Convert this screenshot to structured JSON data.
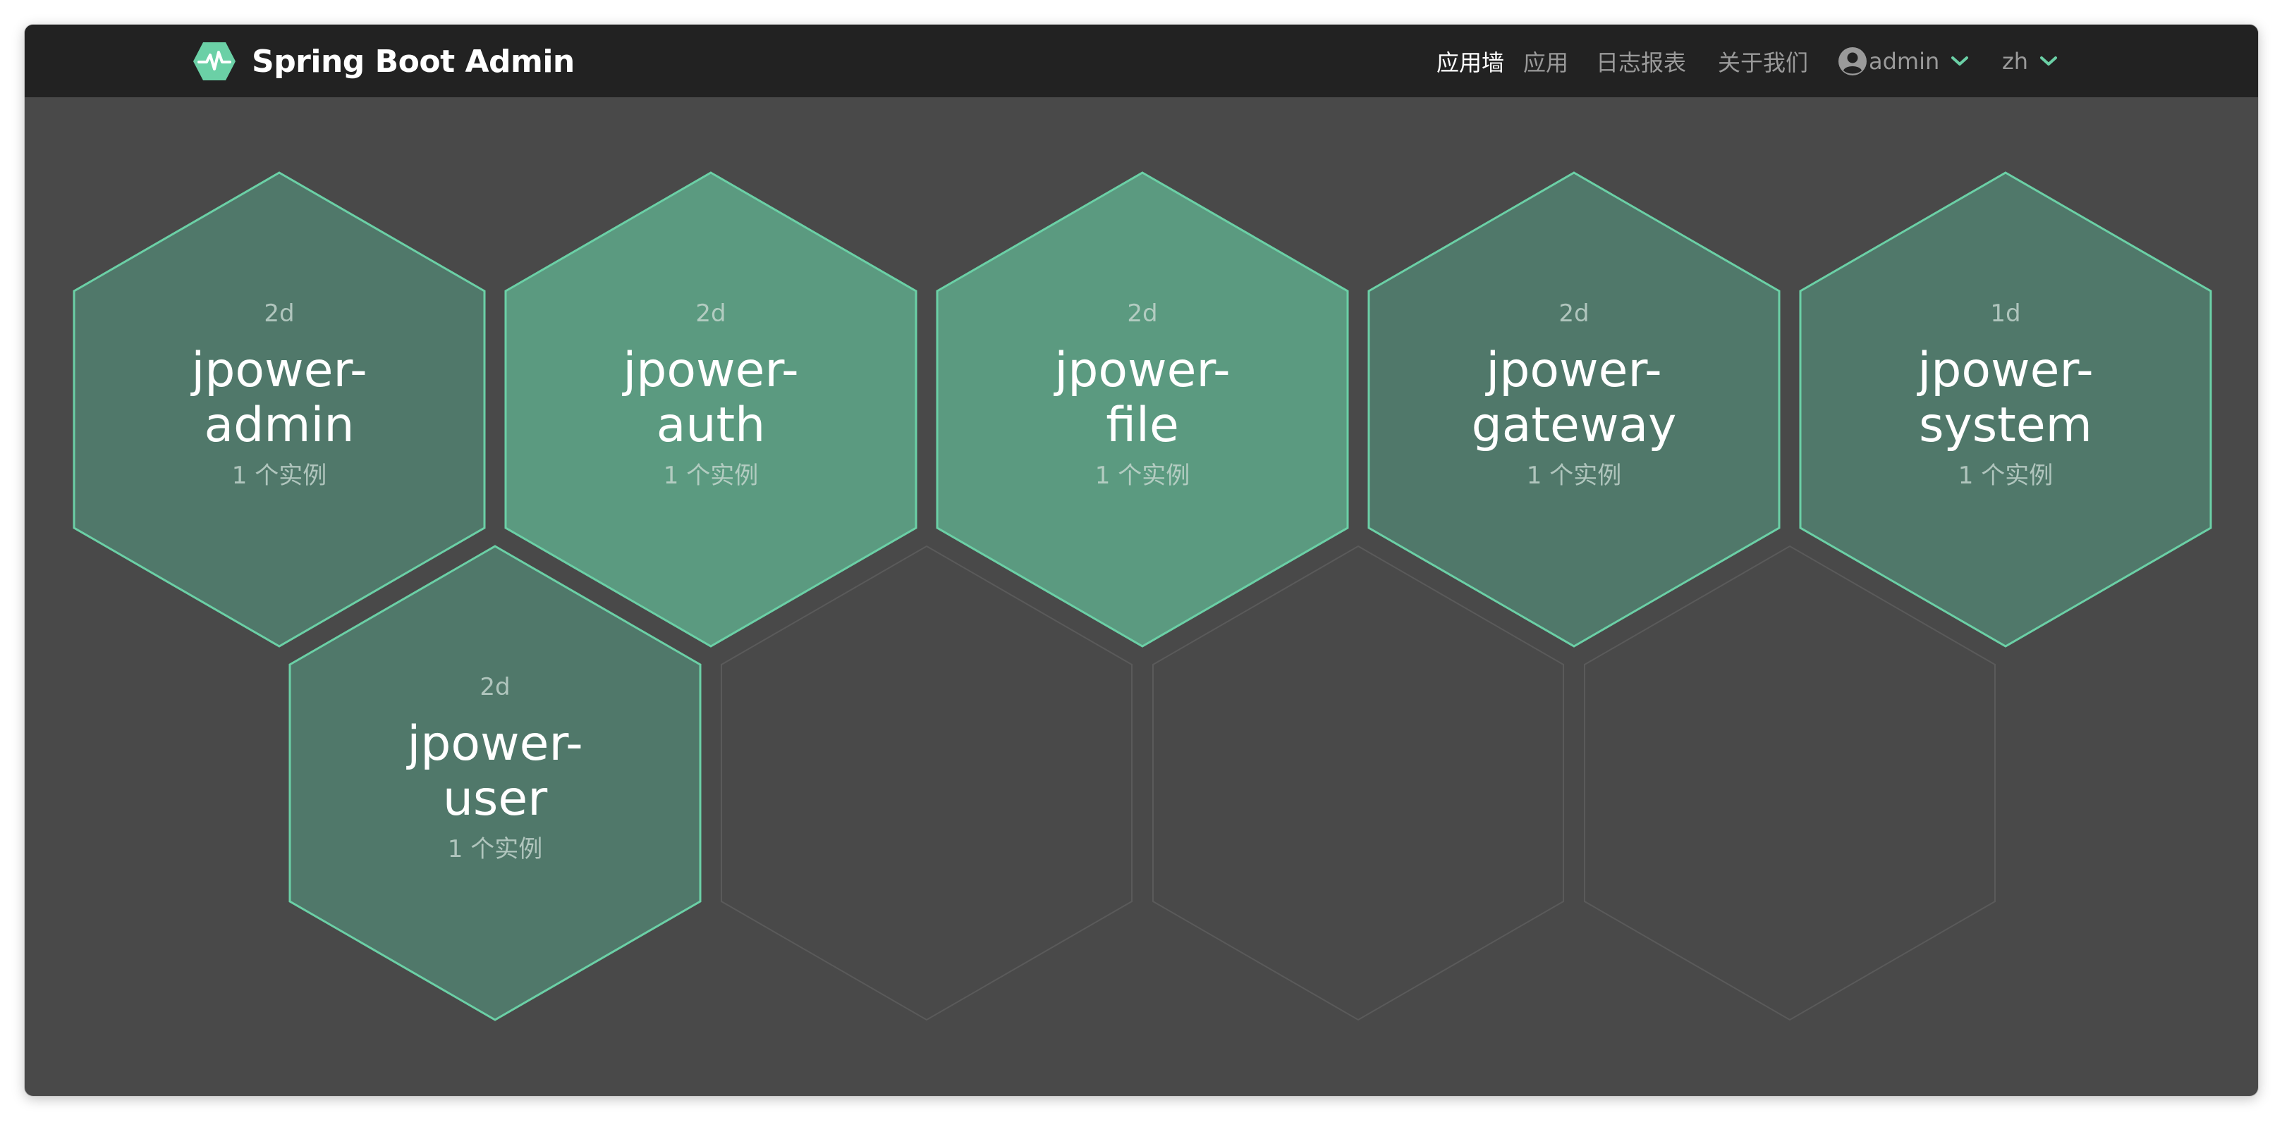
{
  "app": {
    "title": "Spring Boot Admin",
    "accent_color": "#6bd0a6",
    "logo_icon": "pulse-hexagon-icon"
  },
  "nav": {
    "items": [
      {
        "label": "应用墙",
        "active": true
      },
      {
        "label": "应用",
        "active": false
      },
      {
        "label": "日志报表",
        "active": false
      },
      {
        "label": "关于我们",
        "active": false
      }
    ],
    "user": {
      "label": "admin",
      "icon": "user-circle-icon"
    },
    "language": {
      "label": "zh"
    }
  },
  "applications": [
    {
      "age": "2d",
      "name_line1": "jpower-",
      "name_line2": "admin",
      "instances": "1 个实例",
      "highlighted": false
    },
    {
      "age": "2d",
      "name_line1": "jpower-",
      "name_line2": "auth",
      "instances": "1 个实例",
      "highlighted": true
    },
    {
      "age": "2d",
      "name_line1": "jpower-",
      "name_line2": "file",
      "instances": "1 个实例",
      "highlighted": true
    },
    {
      "age": "2d",
      "name_line1": "jpower-",
      "name_line2": "gateway",
      "instances": "1 个实例",
      "highlighted": false
    },
    {
      "age": "1d",
      "name_line1": "jpower-",
      "name_line2": "system",
      "instances": "1 个实例",
      "highlighted": false
    },
    {
      "age": "2d",
      "name_line1": "jpower-",
      "name_line2": "user",
      "instances": "1 个实例",
      "highlighted": false
    }
  ],
  "colors": {
    "hex_fill": "#50786a",
    "hex_fill_highlight": "#5b9a80",
    "hex_stroke": "#6bd0a6",
    "empty_hex_stroke": "#5a5a5a",
    "background": "#494949",
    "navbar": "#222222"
  }
}
